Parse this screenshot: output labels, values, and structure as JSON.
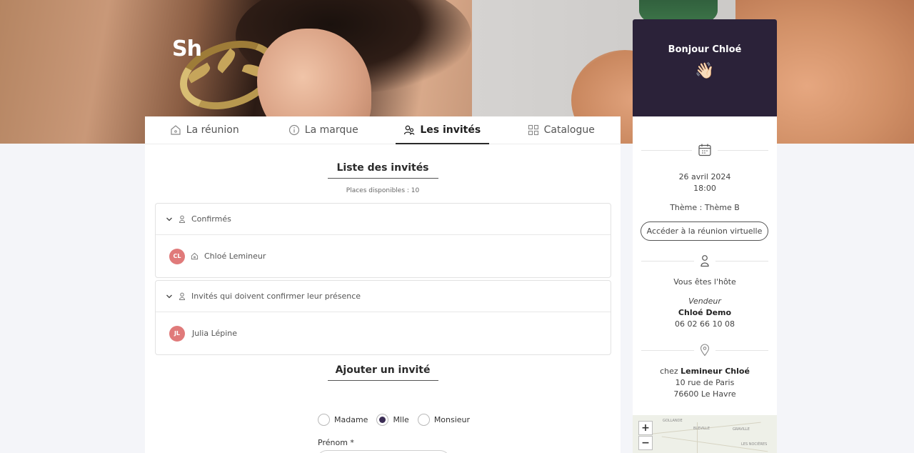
{
  "brand": {
    "logo_text": "Sh"
  },
  "tabs": [
    {
      "label": "La réunion",
      "icon": "home-icon"
    },
    {
      "label": "La marque",
      "icon": "info-icon"
    },
    {
      "label": "Les invités",
      "icon": "guests-icon",
      "active": true
    },
    {
      "label": "Catalogue",
      "icon": "grid-icon"
    }
  ],
  "guests": {
    "title": "Liste des invités",
    "places": "Places disponibles : 10",
    "confirmed": {
      "label": "Confirmés",
      "members": [
        {
          "initials": "CL",
          "name": "Chloé Lemineur",
          "is_host": true
        }
      ]
    },
    "pending": {
      "label": "Invités qui doivent confirmer leur présence",
      "members": [
        {
          "initials": "JL",
          "name": "Julia Lépine"
        }
      ]
    }
  },
  "add_guest": {
    "title": "Ajouter un invité",
    "civility_options": [
      "Madame",
      "Mlle",
      "Monsieur"
    ],
    "civility_selected": "Mlle",
    "firstname_label": "Prénom *"
  },
  "side": {
    "greeting": "Bonjour Chloé",
    "wave": "👋🏻",
    "date": "26 avril 2024",
    "time": "18:00",
    "theme": "Thème : Thème B",
    "virtual_button": "Accéder à la réunion virtuelle",
    "host_text": "Vous êtes l'hôte",
    "seller_role": "Vendeur",
    "seller_name": "Chloé Demo",
    "seller_phone": "06 02 66 10 08",
    "location_prefix": "chez",
    "location_name": "Lemineur Chloé",
    "address_line1": "10 rue de Paris",
    "address_line2": "76600 Le Havre",
    "map_zoom_in": "+",
    "map_zoom_out": "−",
    "map_labels": [
      "GOLLANDE",
      "BLEVILLE",
      "GRAVILLE",
      "LES NOCIÈRES"
    ]
  },
  "colors": {
    "accent": "#2b2239",
    "avatar": "#e07a7a"
  }
}
